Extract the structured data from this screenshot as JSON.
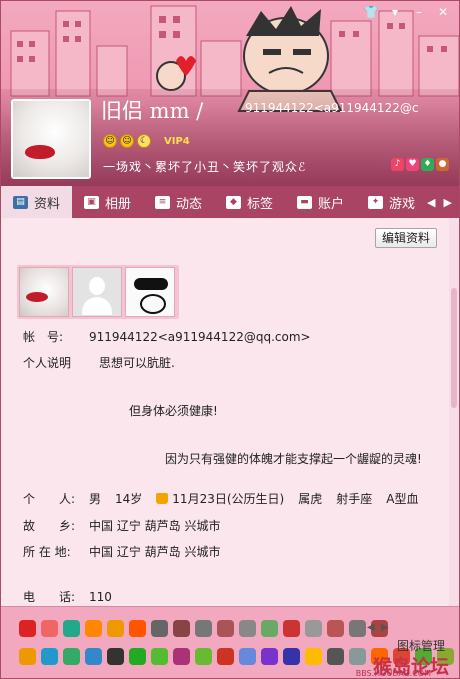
{
  "window": {
    "controls": [
      "👕",
      "▾",
      "–",
      "✕"
    ]
  },
  "profile": {
    "nickname": "旧侣 mm /",
    "account": "911944122<a911944122@c",
    "vip_label": "VIP4",
    "signature": "一场戏丶累坏了小丑丶笑坏了观众ℰ"
  },
  "tabs": [
    {
      "label": "资料",
      "icon": "profile-card-icon",
      "active": true
    },
    {
      "label": "相册",
      "icon": "photo-album-icon"
    },
    {
      "label": "动态",
      "icon": "feed-icon"
    },
    {
      "label": "标签",
      "icon": "tag-icon"
    },
    {
      "label": "账户",
      "icon": "account-icon"
    },
    {
      "label": "游戏",
      "icon": "game-icon"
    }
  ],
  "content": {
    "edit_button": "编辑资料",
    "account_label": "帐　号:",
    "account_value": "911944122<a911944122@qq.com>",
    "desc_label": "个人说明",
    "desc_line1": "思想可以肮脏.",
    "desc_line2": "但身体必须健康!",
    "desc_line3": "因为只有强健的体魄才能支撑起一个龌龊的灵魂!",
    "personal_label": "个　　人:",
    "gender": "男",
    "age": "14岁",
    "birthday": "11月23日(公历生日)",
    "zodiac": "属虎",
    "constellation": "射手座",
    "blood": "A型血",
    "hometown_label": "故　　乡:",
    "hometown_value": "中国 辽宁 葫芦岛 兴城市",
    "location_label": "所 在 地:",
    "location_value": "中国 辽宁 葫芦岛 兴城市",
    "phone_label": "电　　话:",
    "phone_value": "110"
  },
  "iconbar": {
    "manage_label": "图标管理",
    "watermark": "猴岛论坛",
    "watermark_url": "BBS.HOUDAO.COM",
    "row1_colors": [
      "#d22",
      "#e66",
      "#2a8",
      "#f80",
      "#e90",
      "#f50",
      "#666",
      "#844",
      "#777",
      "#a55",
      "#888",
      "#6a6",
      "#c33",
      "#999",
      "#b55",
      "#777",
      "#a44"
    ],
    "row2_colors": [
      "#e90",
      "#29c",
      "#3a6",
      "#38c",
      "#333",
      "#2a2",
      "#5b3",
      "#a37",
      "#6b3",
      "#c32",
      "#68d",
      "#73c",
      "#33a",
      "#fb0",
      "#555",
      "#899",
      "#f60",
      "#d43",
      "#5a3",
      "#8a3"
    ]
  }
}
